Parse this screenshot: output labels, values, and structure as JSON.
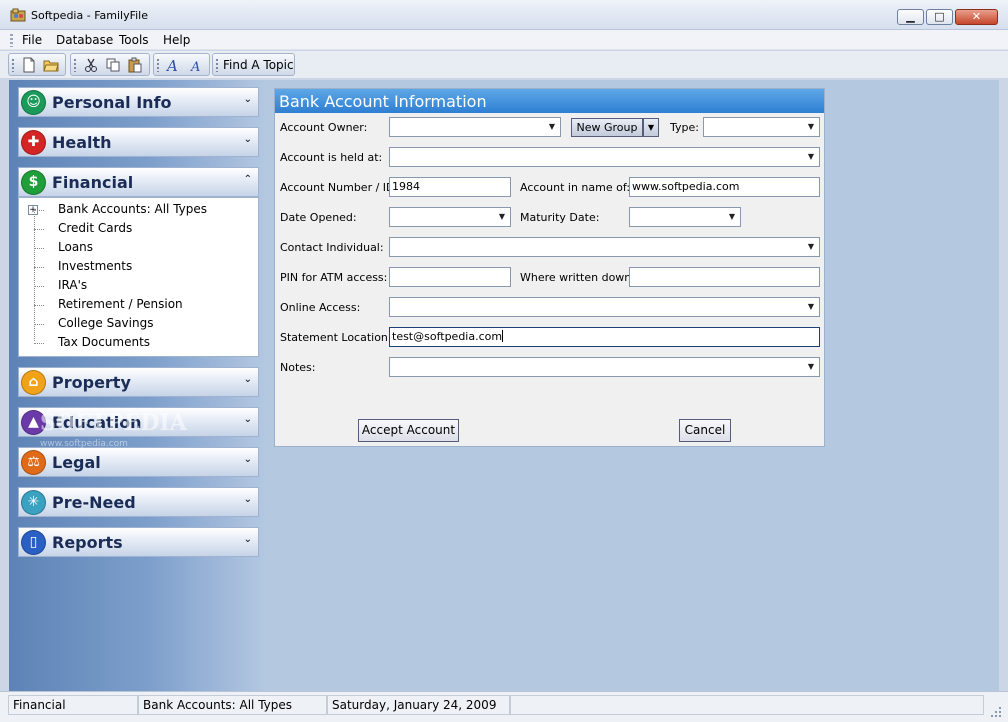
{
  "window": {
    "title": "Softpedia - FamilyFile"
  },
  "menu": [
    "File",
    "Database",
    "Tools",
    "Help"
  ],
  "toolbar": {
    "find_topic": "Find A Topic"
  },
  "sidebar": {
    "sections": [
      {
        "label": "Personal Info",
        "icon": "person-icon",
        "color": "#1b9a5a"
      },
      {
        "label": "Health",
        "icon": "medical-cross-icon",
        "color": "#d42424"
      },
      {
        "label": "Financial",
        "icon": "dollar-icon",
        "color": "#1f9e3a"
      },
      {
        "label": "Property",
        "icon": "house-icon",
        "color": "#f0a21a"
      },
      {
        "label": "Education",
        "icon": "graduation-cap-icon",
        "color": "#6b3aa8"
      },
      {
        "label": "Legal",
        "icon": "scales-icon",
        "color": "#e06a18"
      },
      {
        "label": "Pre-Need",
        "icon": "caduceus-icon",
        "color": "#3aa2c0"
      },
      {
        "label": "Reports",
        "icon": "document-icon",
        "color": "#2a5fc4"
      }
    ],
    "financial_items": [
      "Bank Accounts: All Types",
      "Credit Cards",
      "Loans",
      "Investments",
      "IRA's",
      "Retirement / Pension",
      "College Savings",
      "Tax Documents"
    ]
  },
  "dialog": {
    "title": "Bank Account Information",
    "labels": {
      "account_owner": "Account Owner:",
      "type": "Type:",
      "held_at": "Account is held at:",
      "account_number": "Account Number / ID:",
      "account_name": "Account in name of:",
      "date_opened": "Date Opened:",
      "maturity_date": "Maturity Date:",
      "contact": "Contact Individual:",
      "pin": "PIN for ATM access:",
      "written_down": "Where written down:",
      "online_access": "Online Access:",
      "statement_location": "Statement Location:",
      "notes": "Notes:"
    },
    "values": {
      "account_owner": "",
      "type": "",
      "held_at": "",
      "account_number": "1984",
      "account_name": "www.softpedia.com",
      "date_opened": "",
      "maturity_date": "",
      "contact": "",
      "pin": "",
      "written_down": "",
      "online_access": "",
      "statement_location": "test@softpedia.com",
      "notes": ""
    },
    "new_group": "New Group",
    "accept": "Accept Account",
    "cancel": "Cancel"
  },
  "watermark": {
    "text": "SOFTPEDIA",
    "sub": "www.softpedia.com"
  },
  "status": [
    "Financial",
    "Bank Accounts: All Types",
    "Saturday, January 24, 2009",
    ""
  ]
}
